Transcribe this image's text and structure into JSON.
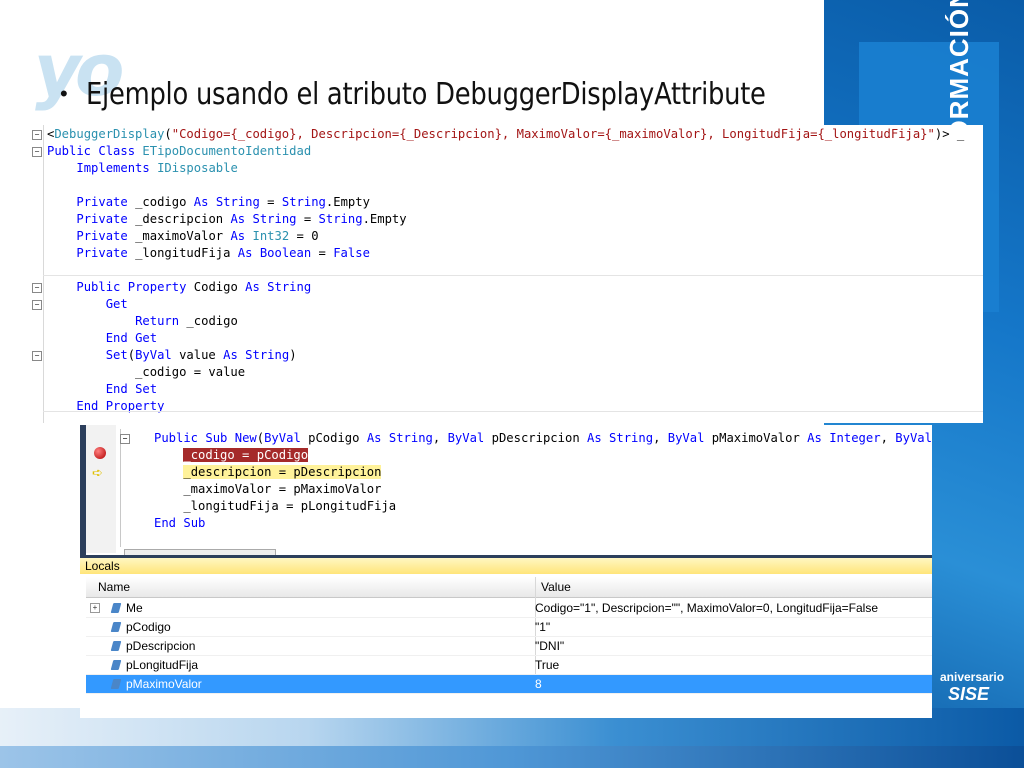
{
  "slide": {
    "title": "Ejemplo usando el atributo DebuggerDisplayAttribute",
    "bullet": "•",
    "logo_text": "yo",
    "side_banner": "LAS DE INFORMACIÓN",
    "anniversary_label": "aniversario",
    "anniversary_brand": "SISE"
  },
  "code_snippet": {
    "lines": [
      "<DebuggerDisplay(\"Codigo={_codigo}, Descripcion={_Descripcion}, MaximoValor={_maximoValor}, LongitudFija={_longitudFija}\")> _",
      "Public Class ETipoDocumentoIdentidad",
      "    Implements IDisposable",
      "",
      "    Private _codigo As String = String.Empty",
      "    Private _descripcion As String = String.Empty",
      "    Private _maximoValor As Int32 = 0",
      "    Private _longitudFija As Boolean = False",
      "",
      "    Public Property Codigo As String",
      "        Get",
      "            Return _codigo",
      "        End Get",
      "        Set(ByVal value As String)",
      "            _codigo = value",
      "        End Set",
      "    End Property"
    ]
  },
  "debug_editor": {
    "lines": [
      "Public Sub New(ByVal pCodigo As String, ByVal pDescripcion As String, ByVal pMaximoValor As Integer, ByVal",
      "    _codigo = pCodigo",
      "    _descripcion = pDescripcion",
      "    _maximoValor = pMaximoValor",
      "    _longitudFija = pLongitudFija",
      "End Sub"
    ],
    "breakpoint_line": "_codigo = pCodigo",
    "current_line": "_descripcion = pDescripcion"
  },
  "locals": {
    "title": "Locals",
    "columns": [
      "Name",
      "Value"
    ],
    "rows": [
      {
        "name": "Me",
        "value": "Codigo=\"1\", Descripcion=\"\", MaximoValor=0, LongitudFija=False",
        "expandable": true,
        "selected": false
      },
      {
        "name": "pCodigo",
        "value": "\"1\"",
        "expandable": false,
        "selected": false
      },
      {
        "name": "pDescripcion",
        "value": "\"DNI\"",
        "expandable": false,
        "selected": false
      },
      {
        "name": "pLongitudFija",
        "value": "True",
        "expandable": false,
        "selected": false
      },
      {
        "name": "pMaximoValor",
        "value": "8",
        "expandable": false,
        "selected": true
      }
    ]
  },
  "colors": {
    "keyword": "#0000ff",
    "string": "#a31515",
    "type": "#2b91af",
    "selection": "#3399ff",
    "brand_blue": "#0b5aa6"
  }
}
